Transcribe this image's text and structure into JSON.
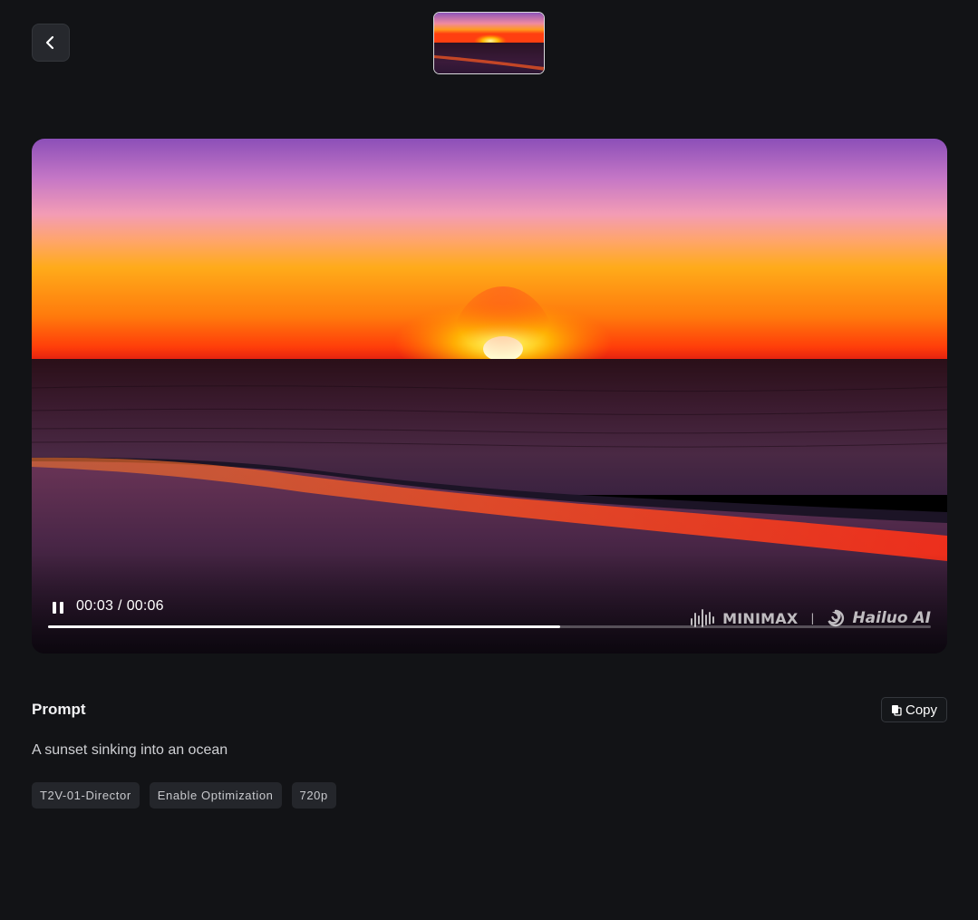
{
  "header": {
    "back_icon": "chevron-left-icon",
    "thumbnail_label": "Sunset over ocean video thumbnail"
  },
  "player": {
    "state": "playing",
    "control_icon": "pause-icon",
    "current_time": "00:03",
    "separator": "/",
    "duration": "00:06",
    "progress": 0.58,
    "watermark": {
      "brand1": "MINIMAX",
      "divider": "|",
      "brand2": "Hailuo AI"
    }
  },
  "prompt": {
    "title": "Prompt",
    "copy_label": "Copy",
    "copy_icon": "copy-icon",
    "text": "A sunset sinking into an ocean"
  },
  "tags": [
    "T2V-01-Director",
    "Enable Optimization",
    "720p"
  ],
  "colors": {
    "background": "#121316",
    "surface": "#24262b",
    "text_primary": "#f2f2f4",
    "text_secondary": "#cfd0d4"
  }
}
